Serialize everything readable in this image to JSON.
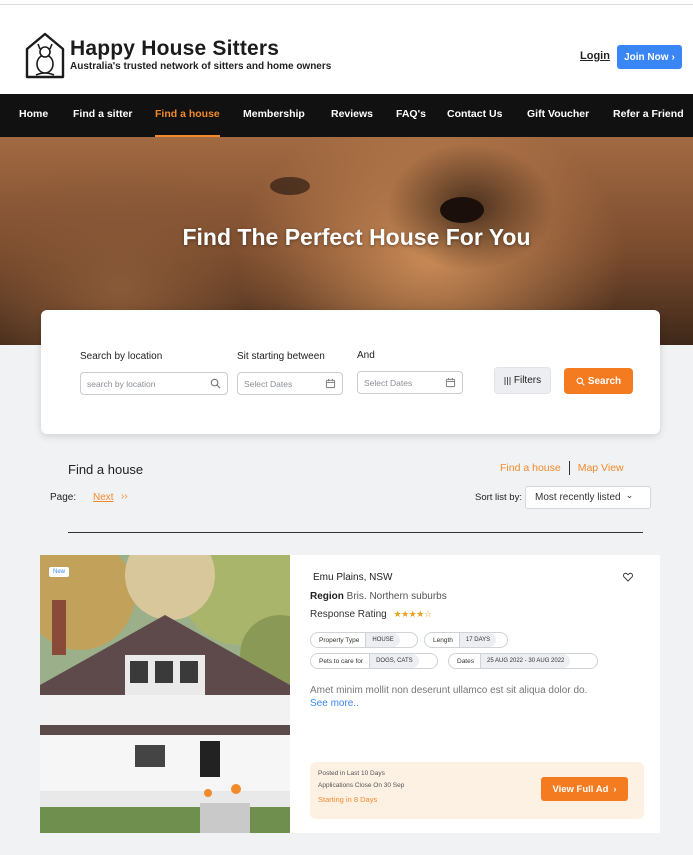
{
  "header": {
    "brand": "Happy House Sitters",
    "tagline": "Australia's trusted network of sitters and home owners",
    "login_label": "Login",
    "join_label": "Join Now",
    "join_arrow": "›"
  },
  "nav": {
    "items": [
      {
        "label": "Home"
      },
      {
        "label": "Find a sitter"
      },
      {
        "label": "Find a house",
        "active": true
      },
      {
        "label": "Membership"
      },
      {
        "label": "Reviews"
      },
      {
        "label": "FAQ's"
      },
      {
        "label": "Contact Us"
      },
      {
        "label": "Gift Voucher"
      },
      {
        "label": "Refer a Friend"
      }
    ]
  },
  "hero": {
    "title": "Find The Perfect House For You"
  },
  "search": {
    "location_label": "Search by location",
    "location_placeholder": "search by location",
    "start_label": "Sit starting between",
    "start_placeholder": "Select Dates",
    "end_label": "And",
    "end_placeholder": "Select Dates",
    "filters_label": "Filters",
    "search_label": "Search"
  },
  "results": {
    "title": "Find a house",
    "tab_list": "Find a house",
    "tab_map": "Map View",
    "page_label": "Page:",
    "next_label": "Next",
    "next_arrows": "››",
    "sort_label": "Sort list by:",
    "sort_value": "Most recently listed",
    "sort_chevron": "⌄"
  },
  "listing": {
    "badge": "New",
    "location": "Emu Plains, NSW",
    "region_label": "Region",
    "region_value": "Bris. Northern suburbs",
    "rating_label": "Response Rating",
    "stars": "★★★★☆",
    "rating_value": 4,
    "property_type_label": "Property Type",
    "property_type_value": "HOUSE",
    "length_label": "Length",
    "length_value": "17 DAYS",
    "pets_label": "Pets to care for",
    "pets_value": "DOGS, CATS",
    "dates_label": "Dates",
    "dates_value": "25 AUG 2022 - 30 AUG 2022",
    "description": "Amet minim mollit non deserunt ullamco est sit aliqua dolor do.",
    "see_more": "See more..",
    "posted": "Posted in Last 10 Days",
    "applications_close": "Applications Close On 30 Sep",
    "starting": "Starting in 8 Days",
    "view_label": "View Full Ad",
    "view_arrow": "›"
  },
  "colors": {
    "accent": "#f47b20",
    "blue": "#3a86f5",
    "nav_bg": "#111111"
  }
}
